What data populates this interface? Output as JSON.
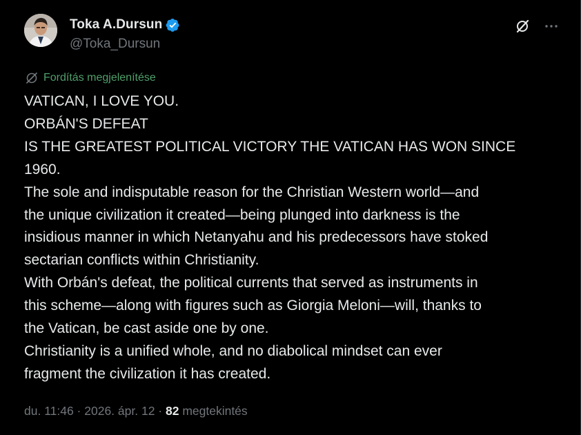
{
  "author": {
    "display_name": "Toka A.Dursun",
    "handle": "@Toka_Dursun",
    "verified": true,
    "verified_color": "#1d9bf0"
  },
  "header_actions": {
    "grok_icon": "grok-slash-circle-icon",
    "more_icon": "more-horizontal-icon"
  },
  "translate": {
    "label": "Fordítás megjelenítése",
    "color": "#4fa06a"
  },
  "tweet": {
    "lines": [
      "VATICAN, I LOVE YOU.",
      "ORBÁN'S DEFEAT",
      "IS THE GREATEST POLITICAL VICTORY THE VATICAN HAS WON SINCE",
      "1960.",
      "The sole and indisputable reason for the Christian Western world—and",
      "the unique civilization it created—being plunged into darkness is the",
      "insidious manner in which Netanyahu and his predecessors have stoked",
      "sectarian conflicts within Christianity.",
      "With Orbán's defeat, the political currents that served as instruments in",
      "this scheme—along with figures such as Giorgia Meloni—will, thanks to",
      "the Vatican, be cast aside one by one.",
      "Christianity is a unified whole, and no diabolical mindset can ever",
      "fragment the civilization it has created."
    ]
  },
  "meta": {
    "time": "du. 11:46",
    "separator": " · ",
    "date": "2026. ápr. 12",
    "views_count": "82",
    "views_label": " megtekintés"
  }
}
